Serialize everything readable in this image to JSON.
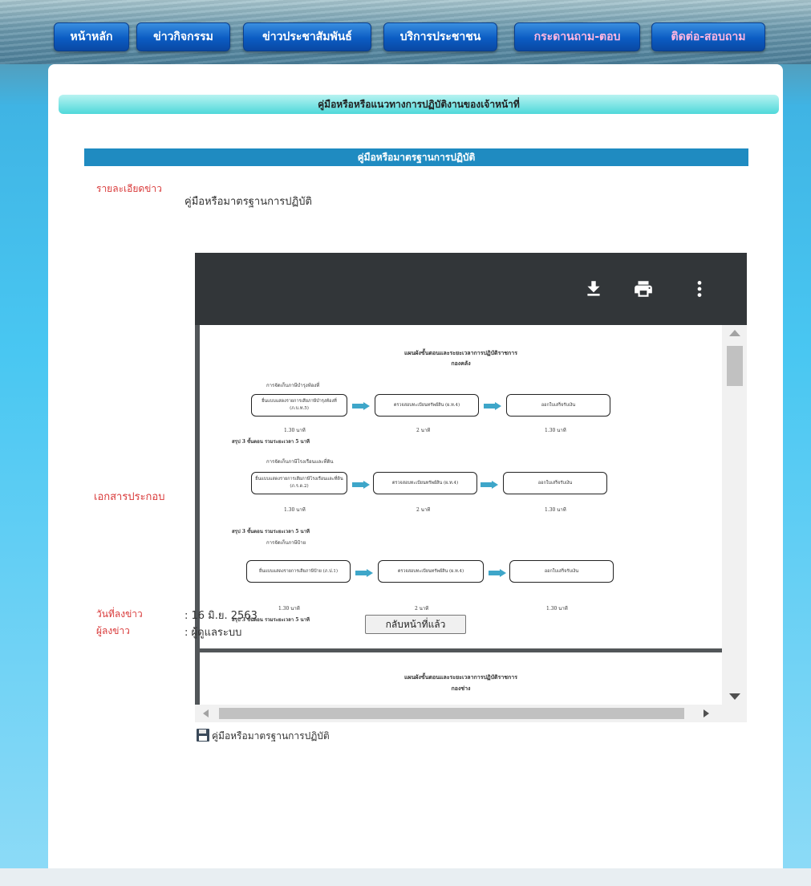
{
  "nav": [
    {
      "label": "หน้าหลัก"
    },
    {
      "label": "ข่าวกิจกรรม"
    },
    {
      "label": "ข่าวประชาสัมพันธ์"
    },
    {
      "label": "บริการประชาชน"
    },
    {
      "label": "กระดานถาม-ตอบ"
    },
    {
      "label": "ติดต่อ-สอบถาม"
    }
  ],
  "page": {
    "title": "คู่มือหรือหรือแนวทางการปฏิบัติงานของเจ้าหน้าที่",
    "subtitle": "คู่มือหรือมาตรฐานการปฏิบัติ"
  },
  "details": {
    "detail_label": "รายละเอียดข่าว",
    "detail_value": "คู่มือหรือมาตรฐานการปฏิบัติ",
    "attachment_label": "เอกสารประกอบ",
    "attachment_link": "คู่มือหรือมาตรฐานการปฏิบัติ",
    "date_label": "วันที่ลงข่าว",
    "date_value": ": 16 มิ.ย. 2563",
    "author_label": "ผู้ลงข่าว",
    "author_value": ": ผู้ดูแลระบบ"
  },
  "viewer": {
    "icons": [
      "download-icon",
      "print-icon",
      "more-options-icon"
    ]
  },
  "document": {
    "heading_line1": "แผนผังขั้นตอนและระยะเวลาการปฏิบัติราชการ",
    "heading_line2": "กองคลัง",
    "sections": [
      {
        "title": "การจัดเก็บภาษีบำรุงท้องที่",
        "steps": [
          "ยื่นแบบแสดงรายการเสียภาษีบำรุงท้องที่ (ภ.บ.ท.5)",
          "ตรวจสอบทะเบียนทรัพย์สิน (ผ.ท.4)",
          "ออกใบเสร็จรับเงิน"
        ],
        "times": [
          "1.30 นาที",
          "2 นาที",
          "1.30 นาที"
        ],
        "summary": "สรุป 3 ขั้นตอน รวมระยะเวลา 5 นาที"
      },
      {
        "title": "การจัดเก็บภาษีโรงเรือนและที่ดิน",
        "steps": [
          "ยื่นแบบแสดงรายการเสียภาษีโรงเรือนและที่ดิน (ภ.ร.ด.2)",
          "ตรวจสอบทะเบียนทรัพย์สิน (ผ.ท.4)",
          "ออกใบเสร็จรับเงิน"
        ],
        "times": [
          "1.30 นาที",
          "2 นาที",
          "1.30 นาที"
        ],
        "summary": "สรุป 3 ขั้นตอน รวมระยะเวลา 5 นาที"
      },
      {
        "title": "การจัดเก็บภาษีป้าย",
        "steps": [
          "ยื่นแบบแสดงรายการเสียภาษีป้าย (ภ.ป.1)",
          "ตรวจสอบทะเบียนทรัพย์สิน (ผ.ท.4)",
          "ออกใบเสร็จรับเงิน"
        ],
        "times": [
          "1.30 นาที",
          "2 นาที",
          "1.30 นาที"
        ],
        "summary": "สรุป 3 ขั้นตอน รวมระยะเวลา 5 นาที"
      }
    ],
    "page2_heading_line1": "แผนผังขั้นตอนและระยะเวลาการปฏิบัติราชการ",
    "page2_heading_line2": "กองช่าง"
  },
  "buttons": {
    "back": "กลับหน้าที่แล้ว"
  },
  "colors": {
    "label_red": "#d93a3a",
    "subbar_blue": "#1f8bc1",
    "nav_blue": "#0b5cc3",
    "arrow_teal": "#3ea6c9"
  }
}
